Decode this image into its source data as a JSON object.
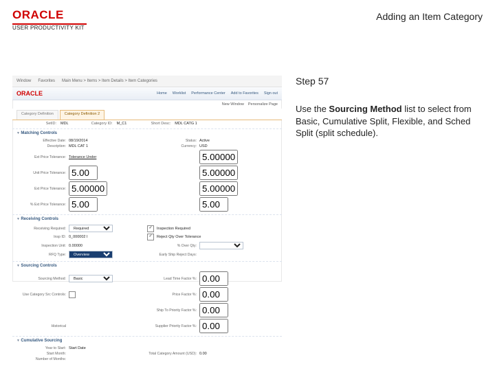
{
  "header": {
    "brand_main": "ORACLE",
    "brand_sub": "USER PRODUCTIVITY KIT",
    "page_title": "Adding an Item Category"
  },
  "side": {
    "step": "Step 57",
    "instr_pre": "Use the ",
    "instr_bold": "Sourcing Method",
    "instr_post": " list to select from Basic, Cumulative Split, Flexible, and Sched Split (split schedule)."
  },
  "shot": {
    "tabbar": [
      "Window",
      "Favorites",
      "Main Menu > Items > Item Details > Item Categories"
    ],
    "brand": "ORACLE",
    "nav": [
      "Home",
      "Worklist",
      "Performance Center",
      "Add to Favorites",
      "Sign out"
    ],
    "pgtitle": [
      "New Window",
      "Personalize Page"
    ],
    "tabs2": {
      "inactive": "Category Definition",
      "active": "Category Definition 2"
    },
    "info": {
      "setid_l": "SetID:",
      "setid_v": "MDL",
      "cat_l": "Category ID:",
      "cat_v": "M_C1",
      "short_l": "Short Desc:",
      "short_v": "MDL CATG 1"
    },
    "section1": "Matching Controls",
    "matching": [
      {
        "l": "Effective Date:",
        "v": "08/19/2014"
      },
      {
        "l": "Status:",
        "v": "Active"
      },
      {
        "l": "Description:",
        "v": "MDL CAT 1"
      },
      {
        "l": "Currency:",
        "v": "USD"
      },
      {
        "l": "Ext Price Tolerance:",
        "r": "Tolerance Under"
      },
      {
        "l": "",
        "v": "5.00000"
      },
      {
        "l": "Unit Price Tolerance:",
        "v": "5.00"
      },
      {
        "l": "",
        "v": "5.00000"
      },
      {
        "l": "Ext Price Tolerance:",
        "v": "5.00000"
      },
      {
        "l": "",
        "v": "5.00000"
      },
      {
        "l": "% Ext Price Tolerance:",
        "v": "5.00"
      },
      {
        "l": "",
        "v": "5.00"
      }
    ],
    "section2": "Receiving Controls",
    "receiving": {
      "required_l": "Receiving Required:",
      "required_v": "Required",
      "insp_l": "Inspection Required",
      "insp_ck": true,
      "tol_l": "Reject Qty Over Tolerance",
      "tol_ck": true,
      "amt_l": "Insp ID:",
      "amt_v": "0_000002 I",
      "ins_l": "Inspection Unit:",
      "ins_v": "0.00000",
      "over_l": "% Over Qty:",
      "over_sel": "",
      "type_l": "RFQ Type:",
      "type_sel": "Overview",
      "days_l": "Early Ship Reject Days:"
    },
    "section3": "Sourcing Controls",
    "sourcing": {
      "method_l": "Sourcing Method:",
      "method_v": "Basic",
      "lead_l": "Lead Time Factor %:",
      "lead_v": "0.00",
      "hist_l": "Use Category Src Controls:",
      "price_l": "Price Factor %:",
      "price_v": "0.00",
      "ship_l": "Ship To Priority Factor %:",
      "ship_v": "0.00",
      "hist2_l": "Historical",
      "supp_l": "Supplier Priority Factor %:",
      "supp_v": "0.00"
    },
    "section4": "Cumulative Sourcing",
    "cumulative": {
      "start_l": "Year to Start:",
      "start_v": "Start Date",
      "month_l": "Start Month:",
      "total_l": "Total Category Amount (USD):",
      "total_v": "0.00",
      "num_l": "Number of Months:"
    }
  }
}
